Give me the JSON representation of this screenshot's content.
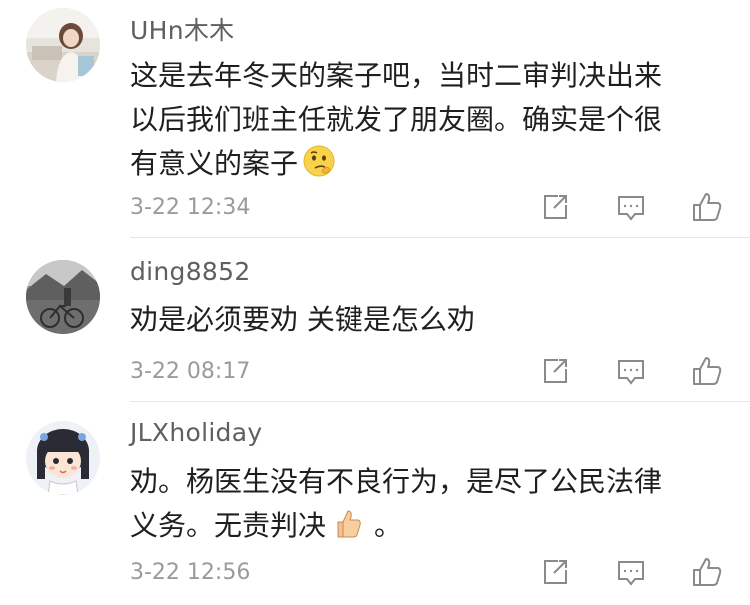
{
  "comments": [
    {
      "username": "UHn木木",
      "lines": [
        "这是去年冬天的案子吧，当时二审判决出来",
        "以后我们班主任就发了朋友圈。确实是个很",
        "有意义的案子"
      ],
      "emoji": "thinking-face-emoji",
      "time": "3-22 12:34",
      "avatar": "girl-at-desk-photo"
    },
    {
      "username": "ding8852",
      "lines": [
        "劝是必须要劝 关键是怎么劝"
      ],
      "time": "3-22 08:17",
      "avatar": "bw-bicycle-street-photo"
    },
    {
      "username": "JLXholiday",
      "lines": [
        "劝。杨医生没有不良行为，是尽了公民法律",
        "义务。无责判决"
      ],
      "emoji": "thumbs-up-emoji",
      "trailing": "。",
      "time": "3-22 12:56",
      "avatar": "cartoon-girl-avatar"
    }
  ],
  "actions": [
    "share-icon",
    "reply-icon",
    "like-icon"
  ],
  "colors": {
    "username": "#5f5f5f",
    "text": "#1f1f1f",
    "time": "#9a9a9a",
    "icon": "#8a8a8a",
    "divider": "#e6e6e6"
  }
}
